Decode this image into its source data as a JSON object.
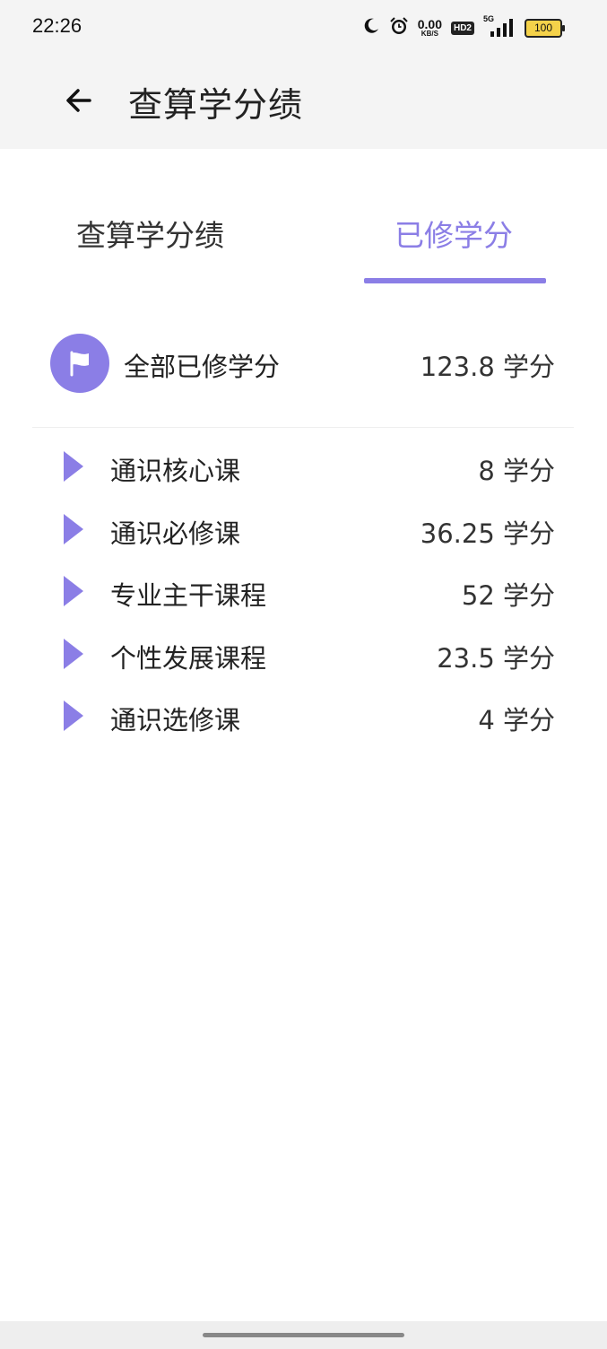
{
  "status_bar": {
    "time": "22:26",
    "net_speed_value": "0.00",
    "net_speed_unit": "KB/S",
    "hd_label": "HD2",
    "signal_label": "5G",
    "battery": "100",
    "icons": [
      "moon-icon",
      "alarm-icon",
      "signal-icon"
    ]
  },
  "app_bar": {
    "title": "查算学分绩",
    "back_icon": "arrow-left-icon"
  },
  "tabs": [
    {
      "label": "查算学分绩",
      "active": false
    },
    {
      "label": "已修学分",
      "active": true
    }
  ],
  "summary": {
    "label": "全部已修学分",
    "value": "123.8 学分",
    "icon": "flag-icon"
  },
  "categories": [
    {
      "label": "通识核心课",
      "value": "8 学分"
    },
    {
      "label": "通识必修课",
      "value": "36.25 学分"
    },
    {
      "label": "专业主干课程",
      "value": "52 学分"
    },
    {
      "label": "个性发展课程",
      "value": "23.5 学分"
    },
    {
      "label": "通识选修课",
      "value": "4 学分"
    }
  ],
  "colors": {
    "accent": "#8b7ee6",
    "header_bg": "#f4f4f4"
  }
}
